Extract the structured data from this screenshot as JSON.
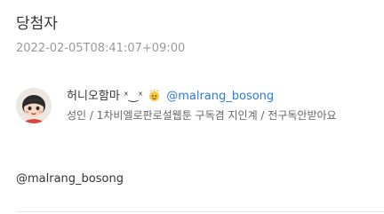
{
  "header": {
    "title": "당첨자",
    "timestamp": "2022-02-05T08:41:07+09:00"
  },
  "winner": {
    "display_name": "허니오함마 ˣ‿ˣ",
    "badge_icon": "sparkle-face-icon",
    "handle": "@malrang_bosong",
    "bio": "성인 / 1차비엘로판로설웹툰 구독겸 지인계 / 전구독안받아요",
    "avatar_icon": "anime-character-avatar"
  },
  "content": {
    "mention": "@malrang_bosong"
  },
  "colors": {
    "link": "#2a7bd3",
    "muted": "#999999",
    "text": "#333333"
  }
}
